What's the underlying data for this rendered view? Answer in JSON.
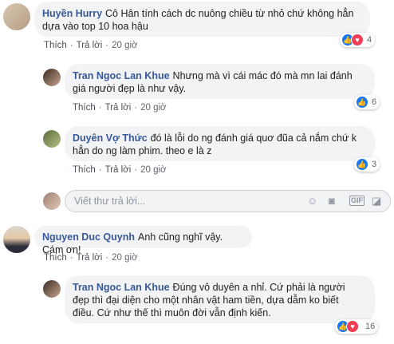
{
  "comments": [
    {
      "name": "Huyền Hurry",
      "text_line1": "Cô Hân tính cách dc nuông chiều từ nhỏ chứ không hẳn",
      "text_line2": "dựa vào top 10 hoa hậu",
      "like_label": "Thích",
      "reply_label": "Trả lời",
      "time": "20 giờ",
      "reaction_count": "4",
      "reactions": [
        "like-icon",
        "love-icon"
      ]
    },
    {
      "name": "Tran Ngoc Lan Khue",
      "text_line1": "Nhưng mà vì cái mác đó mà mn lai đánh",
      "text_line2": "giá người đẹp là như vậy.",
      "like_label": "Thích",
      "reply_label": "Trả lời",
      "time": "20 giờ",
      "reaction_count": "6",
      "reactions": [
        "like-icon"
      ]
    },
    {
      "name": "Duyên Vợ Thức",
      "text_line1": "đó là lỗi do ng đánh giá quơ đũa cả nắm chứ k",
      "text_line2": "hẳn do ng làm phim. theo e là z",
      "like_label": "Thích",
      "reply_label": "Trả lời",
      "time": "20 giờ",
      "reaction_count": "3",
      "reactions": [
        "like-icon"
      ]
    },
    {
      "name": "Nguyen Duc Quynh",
      "text_line1": "Anh cũng nghĩ vậy. Cám ơn!",
      "like_label": "Thích",
      "reply_label": "Trả lời",
      "time": "20 giờ"
    },
    {
      "name": "Tran Ngoc Lan Khue",
      "text_line1": "Đúng vô duyên a nhỉ. Cứ phải là người",
      "text_line2": "đẹp thì đại diện cho một nhân vật ham tiền, dựa dẫm ko biết",
      "text_line3": "điều. Cứ như thế thì muôn đời vẫn định kiến.",
      "reaction_count": "16",
      "reactions": [
        "like-icon",
        "love-icon"
      ]
    }
  ],
  "reply_box": {
    "placeholder": "Viết thư trả lời...",
    "icons": [
      "emoji-icon",
      "camera-icon",
      "gif-icon",
      "sticker-icon"
    ]
  },
  "colors": {
    "name": "#385898",
    "bubble": "#f2f3f5",
    "like": "#1877f2",
    "love": "#f33e58"
  }
}
